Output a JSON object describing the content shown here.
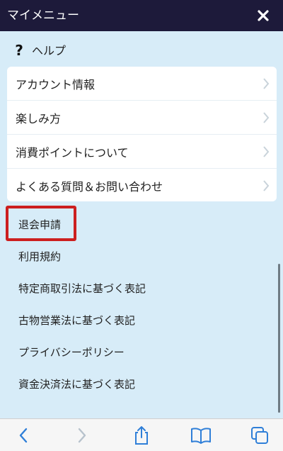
{
  "header": {
    "title": "マイメニュー",
    "close_icon": "close-icon"
  },
  "help": {
    "icon": "question-icon",
    "label": "ヘルプ"
  },
  "card_items": [
    {
      "label": "アカウント情報"
    },
    {
      "label": "楽しみ方"
    },
    {
      "label": "消費ポイントについて"
    },
    {
      "label": "よくある質問＆お問い合わせ"
    }
  ],
  "links": [
    {
      "label": "退会申請"
    },
    {
      "label": "利用規約"
    },
    {
      "label": "特定商取引法に基づく表記"
    },
    {
      "label": "古物営業法に基づく表記"
    },
    {
      "label": "プライバシーポリシー"
    },
    {
      "label": "資金決済法に基づく表記"
    }
  ],
  "colors": {
    "header_bg": "#1d1a3a",
    "page_bg": "#d7ecf8",
    "highlight": "#cc1f1f",
    "toolbar_icon": "#2f7fd8"
  },
  "toolbar": {
    "icons": [
      "back-icon",
      "forward-icon",
      "share-icon",
      "bookmarks-icon",
      "tabs-icon"
    ]
  }
}
